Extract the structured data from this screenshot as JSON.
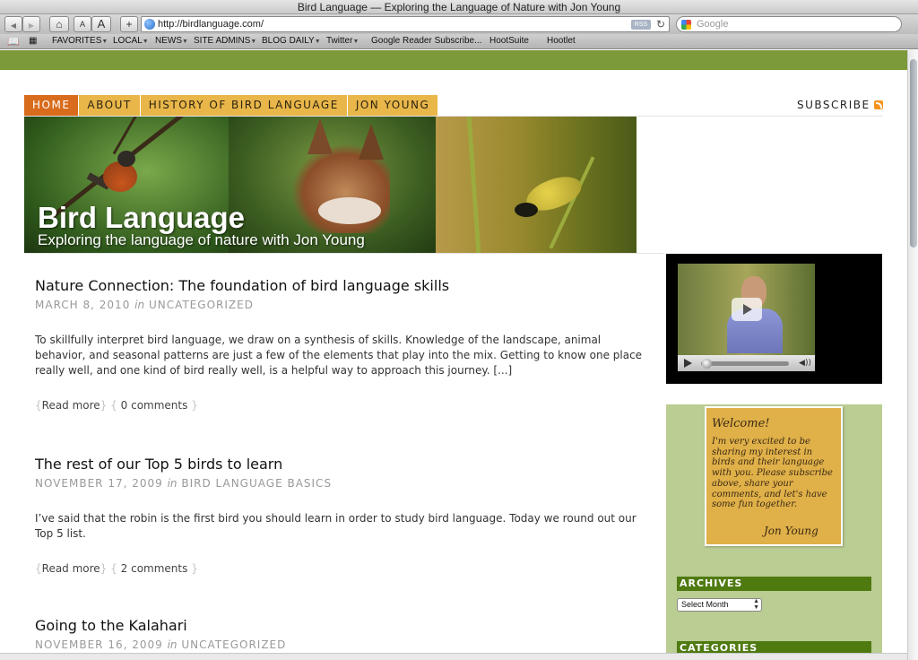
{
  "browser": {
    "window_title": "Bird Language — Exploring the Language of Nature with Jon Young",
    "url": "http://birdlanguage.com/",
    "search_placeholder": "Google",
    "rss_label": "RSS",
    "reload_glyph": "↻",
    "home_glyph": "⌂",
    "text_small": "A",
    "text_large": "A",
    "add_glyph": "+",
    "back_glyph": "◀",
    "forward_glyph": "▶",
    "bookmarks": [
      {
        "label": "FAVORITES",
        "menu": true
      },
      {
        "label": "LOCAL",
        "menu": true
      },
      {
        "label": "NEWS",
        "menu": true
      },
      {
        "label": "SITE ADMINS",
        "menu": true
      },
      {
        "label": "BLOG DAILY",
        "menu": true
      },
      {
        "label": "Twitter",
        "menu": true
      },
      {
        "label": "Google Reader Subscribe...",
        "menu": false
      },
      {
        "label": "HootSuite",
        "menu": false
      },
      {
        "label": "Hootlet",
        "menu": false
      }
    ]
  },
  "nav": {
    "tabs": [
      "HOME",
      "ABOUT",
      "HISTORY OF BIRD LANGUAGE",
      "JON YOUNG"
    ],
    "active_index": 0,
    "subscribe": "SUBSCRIBE"
  },
  "banner": {
    "title": "Bird Language",
    "subtitle": "Exploring the language of nature with Jon Young"
  },
  "posts": [
    {
      "title": "Nature Connection: The foundation of bird language skills",
      "date": "MARCH 8, 2010",
      "in": "in",
      "category": "UNCATEGORIZED",
      "excerpt": "To skillfully interpret bird language, we draw on a synthesis of skills. Knowledge of the landscape, animal behavior, and seasonal patterns are just a few of the elements that play into the mix. Getting to know one place really well, and one kind of bird really well, is a helpful way to approach this journey. [...]",
      "read_more": "Read more",
      "comments": "0 comments"
    },
    {
      "title": "The rest of our Top 5 birds to learn",
      "date": "NOVEMBER 17, 2009",
      "in": "in",
      "category": "BIRD LANGUAGE BASICS",
      "excerpt": "I’ve said that the robin is the first bird you should learn in order to study bird language. Today we round out our Top 5 list.",
      "read_more": "Read more",
      "comments": "2 comments"
    },
    {
      "title": "Going to the Kalahari",
      "date": "NOVEMBER 16, 2009",
      "in": "in",
      "category": "UNCATEGORIZED"
    }
  ],
  "sidebar": {
    "welcome_title": "Welcome!",
    "welcome_body": "I'm very excited to be sharing my interest in birds and their language with you. Please subscribe above, share your comments, and let's have some fun together.",
    "welcome_signature": "Jon Young",
    "archives_heading": "ARCHIVES",
    "archives_select": "Select Month",
    "categories_heading": "CATEGORIES"
  },
  "colors": {
    "nav_tab": "#e9b64a",
    "nav_active": "#d96b1c",
    "green_band": "#7c9a3a",
    "sidebar_green": "#bacd93",
    "widget_heading": "#4f7a10",
    "welcome_note": "#e0b049"
  },
  "icons": [
    "back-icon",
    "forward-icon",
    "home-icon",
    "globe-icon",
    "rss-icon",
    "reload-icon",
    "google-icon",
    "bookmarks-book-icon",
    "top-sites-grid-icon",
    "feed-icon",
    "play-icon",
    "volume-icon"
  ]
}
